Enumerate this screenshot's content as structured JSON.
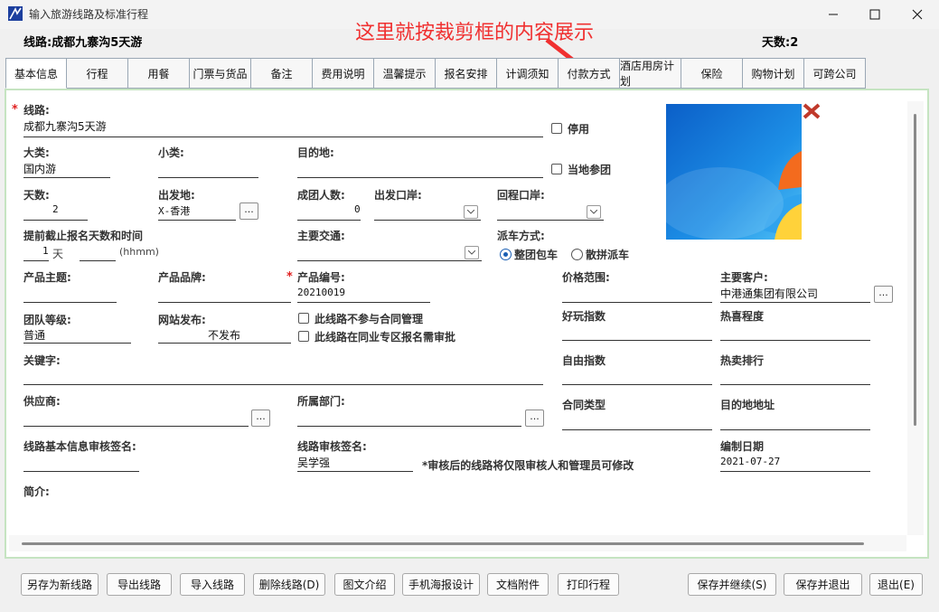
{
  "window": {
    "title": "输入旅游线路及标准行程"
  },
  "summary": {
    "route_label": "线路:成都九寨沟5天游",
    "days_label": "天数:2"
  },
  "annotation": {
    "text": "这里就按裁剪框的内容展示"
  },
  "tabs": [
    "基本信息",
    "行程",
    "用餐",
    "门票与货品",
    "备注",
    "费用说明",
    "温馨提示",
    "报名安排",
    "计调须知",
    "付款方式",
    "酒店用房计划",
    "保险",
    "购物计划",
    "可跨公司"
  ],
  "form": {
    "route": {
      "label": "线路:",
      "value": "成都九寨沟5天游"
    },
    "disabled_label": "停用",
    "major_category": {
      "label": "大类:",
      "value": "国内游"
    },
    "minor_category": {
      "label": "小类:",
      "value": ""
    },
    "destination": {
      "label": "目的地:",
      "value": ""
    },
    "local_join_label": "当地参团",
    "days": {
      "label": "天数:",
      "value": "2"
    },
    "departure": {
      "label": "出发地:",
      "value": "X-香港"
    },
    "min_group": {
      "label": "成团人数:",
      "value": "0"
    },
    "depart_port": {
      "label": "出发口岸:",
      "value": ""
    },
    "return_port": {
      "label": "回程口岸:",
      "value": ""
    },
    "deadline": {
      "label": "提前截止报名天数和时间",
      "days_value": "1",
      "days_unit": "天",
      "time_hint": "(hhmm)"
    },
    "transport": {
      "label": "主要交通:",
      "value": ""
    },
    "dispatch": {
      "label": "派车方式:",
      "option1": "整团包车",
      "option2": "散拼派车"
    },
    "theme": {
      "label": "产品主题:"
    },
    "brand": {
      "label": "产品品牌:"
    },
    "product_code": {
      "label": "产品编号:",
      "value": "20210019"
    },
    "price_range": {
      "label": "价格范围:"
    },
    "main_client": {
      "label": "主要客户:",
      "value": "中港通集团有限公司"
    },
    "group_level": {
      "label": "团队等级:",
      "value": "普通"
    },
    "web_publish": {
      "label": "网站发布:",
      "value": "不发布"
    },
    "no_contract_label": "此线路不参与合同管理",
    "peer_review_label": "此线路在同业专区报名需审批",
    "fun_index": {
      "label": "好玩指数"
    },
    "popularity": {
      "label": "热喜程度"
    },
    "keywords": {
      "label": "关键字:"
    },
    "freedom_index": {
      "label": "自由指数"
    },
    "hot_rank": {
      "label": "热卖排行"
    },
    "supplier": {
      "label": "供应商:"
    },
    "department": {
      "label": "所属部门:"
    },
    "contract_type": {
      "label": "合同类型"
    },
    "dest_address": {
      "label": "目的地地址"
    },
    "basic_review": {
      "label": "线路基本信息审核签名:"
    },
    "route_review": {
      "label": "线路审核签名:",
      "value": "吴学强"
    },
    "review_note": "*审核后的线路将仅限审核人和管理员可修改",
    "compile_date": {
      "label": "编制日期",
      "value": "2021-07-27"
    },
    "intro": {
      "label": "简介:"
    },
    "ellipsis": "..."
  },
  "buttons": {
    "save_as_new": "另存为新线路",
    "export": "导出线路",
    "import": "导入线路",
    "delete": "删除线路(D)",
    "graphic_intro": "图文介绍",
    "mobile_poster": "手机海报设计",
    "attachments": "文档附件",
    "print": "打印行程",
    "save_continue": "保存并继续(S)",
    "save_exit": "保存并退出",
    "exit": "退出(E)"
  }
}
